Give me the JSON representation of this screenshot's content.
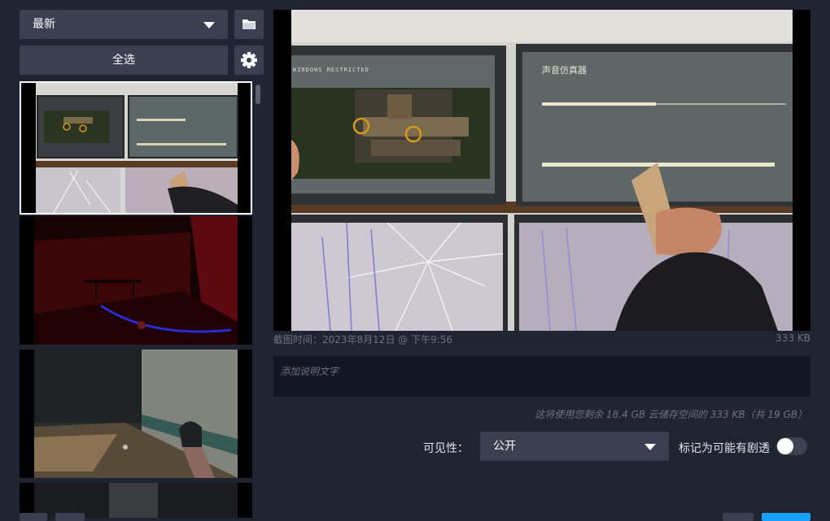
{
  "sidebar": {
    "sort_select": {
      "value": "最新"
    },
    "select_all_label": "全选",
    "folder_icon": "folder-icon",
    "gear_icon": "gear-icon",
    "thumbnails": [
      {
        "scene": "monitors-with-map",
        "selected": true
      },
      {
        "scene": "red-room",
        "selected": false
      },
      {
        "scene": "dark-hallway-camera",
        "selected": false
      },
      {
        "scene": "dark-partial",
        "selected": false
      }
    ]
  },
  "preview": {
    "screenshot_time": "截图时间：2023年8月12日 @ 下午9:56",
    "file_size": "333 KB",
    "screen_left_title": "WINDOWS RESTRICTED",
    "screen_right_title": "声音仿真器"
  },
  "caption": {
    "placeholder": "添加说明文字",
    "value": ""
  },
  "storage_note": "这将使用您剩余 18.4 GB 云储存空间的 333 KB（共 19 GB）",
  "visibility": {
    "label": "可见性：",
    "value": "公开"
  },
  "spoiler": {
    "label": "标记为可能有剧透",
    "checked": false
  },
  "colors": {
    "accent": "#1a9fff",
    "panel": "#3a4050",
    "background": "#1f2430"
  }
}
